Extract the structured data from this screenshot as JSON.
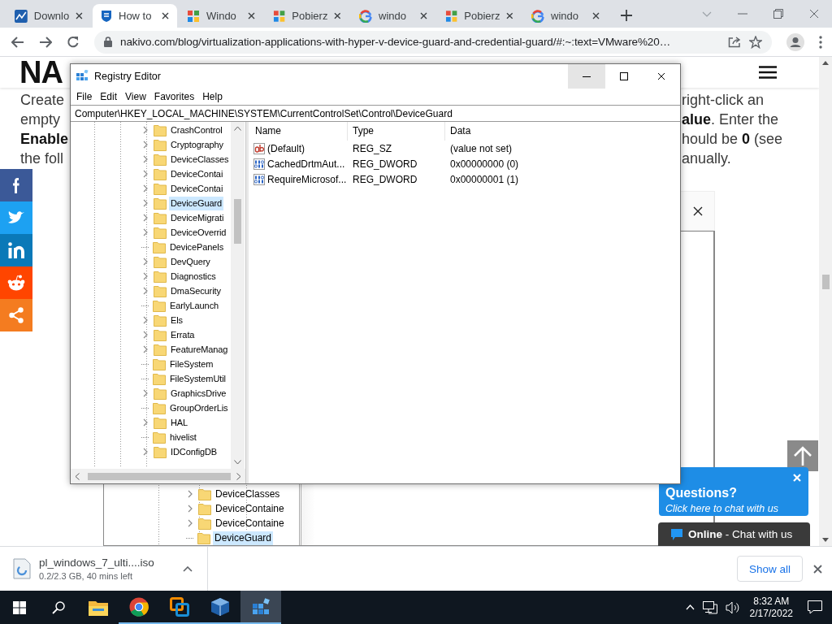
{
  "browser": {
    "tabs": [
      {
        "title": "Downlo",
        "kind": "chart",
        "selected": false
      },
      {
        "title": "How to",
        "kind": "shield",
        "selected": true
      },
      {
        "title": "Windo",
        "kind": "windows",
        "selected": false
      },
      {
        "title": "Pobierz",
        "kind": "windows",
        "selected": false
      },
      {
        "title": "windo",
        "kind": "google",
        "selected": false
      },
      {
        "title": "Pobierz",
        "kind": "windows",
        "selected": false
      },
      {
        "title": "windo",
        "kind": "google",
        "selected": false
      }
    ],
    "url": "nakivo.com/blog/virtualization-applications-with-hyper-v-device-guard-and-credential-guard/#:~:text=VMware%20…"
  },
  "page": {
    "logo": "NA",
    "text_left": [
      "Create",
      "empty",
      "**Enable**",
      "the foll"
    ],
    "text_right": [
      "right-click an",
      "**alue**. Enter the",
      "hould be **0** (see",
      "anually."
    ],
    "share_buttons": [
      {
        "kind": "facebook",
        "color": "#3b5998"
      },
      {
        "kind": "twitter",
        "color": "#1da1f2"
      },
      {
        "kind": "linkedin",
        "color": "#0a79b8"
      },
      {
        "kind": "reddit",
        "color": "#ff4500"
      },
      {
        "kind": "share",
        "color": "#f47c20"
      }
    ],
    "figure_tree": [
      {
        "label": "DeviceClasses",
        "has_children": true,
        "selected": false
      },
      {
        "label": "DeviceContaine",
        "has_children": true,
        "selected": false
      },
      {
        "label": "DeviceContaine",
        "has_children": true,
        "selected": false
      },
      {
        "label": "DeviceGuard",
        "has_children": false,
        "selected": true
      }
    ],
    "chat": {
      "title": "Questions?",
      "subtitle": "Click here to chat with us",
      "status": "**Online** - Chat with us"
    }
  },
  "registry_editor": {
    "title": "Registry Editor",
    "menu": [
      "File",
      "Edit",
      "View",
      "Favorites",
      "Help"
    ],
    "path": "Computer\\HKEY_LOCAL_MACHINE\\SYSTEM\\CurrentControlSet\\Control\\DeviceGuard",
    "tree": [
      {
        "label": "CrashControl",
        "has_children": true,
        "selected": false
      },
      {
        "label": "Cryptography",
        "has_children": true,
        "selected": false
      },
      {
        "label": "DeviceClasses",
        "has_children": true,
        "selected": false
      },
      {
        "label": "DeviceContai",
        "has_children": true,
        "selected": false
      },
      {
        "label": "DeviceContai",
        "has_children": true,
        "selected": false
      },
      {
        "label": "DeviceGuard",
        "has_children": true,
        "selected": true
      },
      {
        "label": "DeviceMigrati",
        "has_children": true,
        "selected": false
      },
      {
        "label": "DeviceOverrid",
        "has_children": true,
        "selected": false
      },
      {
        "label": "DevicePanels",
        "has_children": false,
        "selected": false
      },
      {
        "label": "DevQuery",
        "has_children": true,
        "selected": false
      },
      {
        "label": "Diagnostics",
        "has_children": true,
        "selected": false
      },
      {
        "label": "DmaSecurity",
        "has_children": true,
        "selected": false
      },
      {
        "label": "EarlyLaunch",
        "has_children": false,
        "selected": false
      },
      {
        "label": "Els",
        "has_children": true,
        "selected": false
      },
      {
        "label": "Errata",
        "has_children": true,
        "selected": false
      },
      {
        "label": "FeatureManag",
        "has_children": true,
        "selected": false
      },
      {
        "label": "FileSystem",
        "has_children": false,
        "selected": false
      },
      {
        "label": "FileSystemUtil",
        "has_children": false,
        "selected": false
      },
      {
        "label": "GraphicsDrive",
        "has_children": true,
        "selected": false
      },
      {
        "label": "GroupOrderLis",
        "has_children": false,
        "selected": false
      },
      {
        "label": "HAL",
        "has_children": true,
        "selected": false
      },
      {
        "label": "hivelist",
        "has_children": false,
        "selected": false
      },
      {
        "label": "IDConfigDB",
        "has_children": true,
        "selected": false
      }
    ],
    "columns": [
      "Name",
      "Type",
      "Data"
    ],
    "values": [
      {
        "kind": "string",
        "name": "(Default)",
        "type": "REG_SZ",
        "data": "(value not set)"
      },
      {
        "kind": "dword",
        "name": "CachedDrtmAut...",
        "type": "REG_DWORD",
        "data": "0x00000000 (0)"
      },
      {
        "kind": "dword",
        "name": "RequireMicrosof...",
        "type": "REG_DWORD",
        "data": "0x00000001 (1)"
      }
    ]
  },
  "download_bar": {
    "file": "pl_windows_7_ulti....iso",
    "status": "0.2/2.3 GB, 40 mins left",
    "show_all": "Show all"
  },
  "taskbar": {
    "apps": [
      {
        "kind": "explorer",
        "running": false,
        "active": false
      },
      {
        "kind": "chrome",
        "running": true,
        "active": false
      },
      {
        "kind": "vmware",
        "running": true,
        "active": false
      },
      {
        "kind": "virtualbox",
        "running": true,
        "active": false
      },
      {
        "kind": "regedit",
        "running": true,
        "active": true
      }
    ],
    "time": "8:32 AM",
    "date": "2/17/2022"
  }
}
